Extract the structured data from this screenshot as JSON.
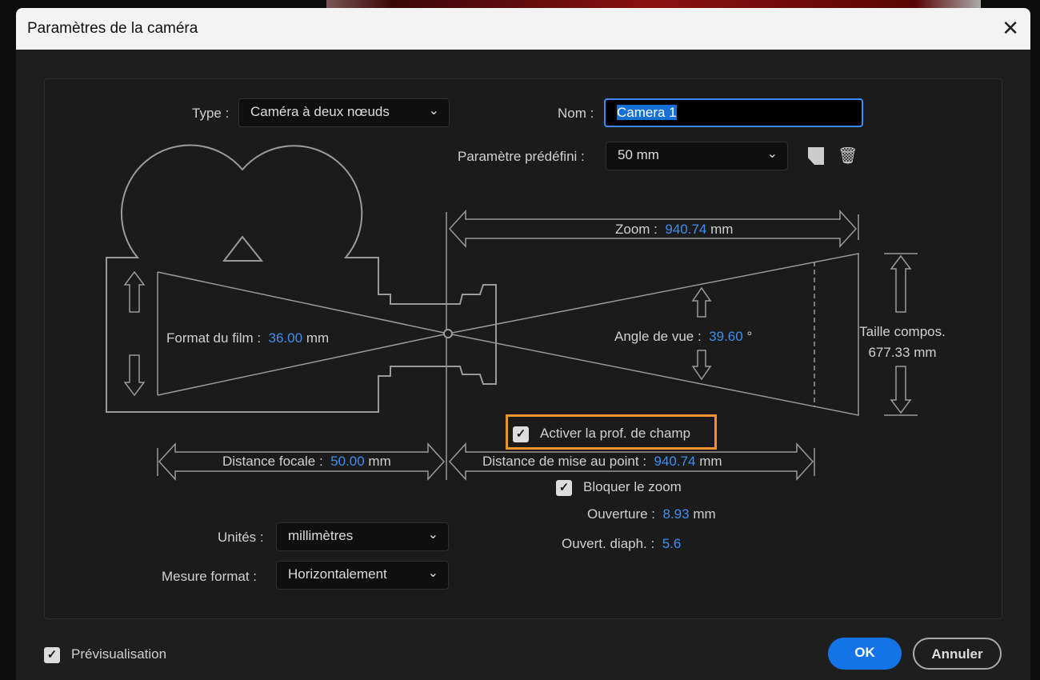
{
  "dialog": {
    "title": "Paramètres de la caméra",
    "close": "✕"
  },
  "type": {
    "label": "Type :",
    "value": "Caméra à deux nœuds"
  },
  "name": {
    "label": "Nom :",
    "value": "Camera 1"
  },
  "preset": {
    "label": "Paramètre prédéfini :",
    "value": "50 mm"
  },
  "zoom": {
    "label": "Zoom :",
    "value": "940.74",
    "unit": "mm"
  },
  "film": {
    "label": "Format du film :",
    "value": "36.00",
    "unit": "mm"
  },
  "angle": {
    "label": "Angle de vue :",
    "value": "39.60",
    "unit": "°"
  },
  "comp": {
    "label": "Taille compos.",
    "value": "677.33 mm"
  },
  "dof": {
    "label": "Activer la prof. de champ",
    "checked": true
  },
  "focal": {
    "label": "Distance focale :",
    "value": "50.00",
    "unit": "mm"
  },
  "focus": {
    "label": "Distance de mise au point :",
    "value": "940.74",
    "unit": "mm"
  },
  "lockzoom": {
    "label": "Bloquer le zoom",
    "checked": true
  },
  "aperture": {
    "label": "Ouverture :",
    "value": "8.93",
    "unit": "mm"
  },
  "fstop": {
    "label": "Ouvert. diaph. :",
    "value": "5.6"
  },
  "units": {
    "label": "Unités :",
    "value": "millimètres"
  },
  "measure": {
    "label": "Mesure format :",
    "value": "Horizontalement"
  },
  "preview": {
    "label": "Prévisualisation",
    "checked": true
  },
  "buttons": {
    "ok": "OK",
    "cancel": "Annuler"
  },
  "colors": {
    "accent": "#3d8ff0",
    "highlight": "#f0922a"
  }
}
